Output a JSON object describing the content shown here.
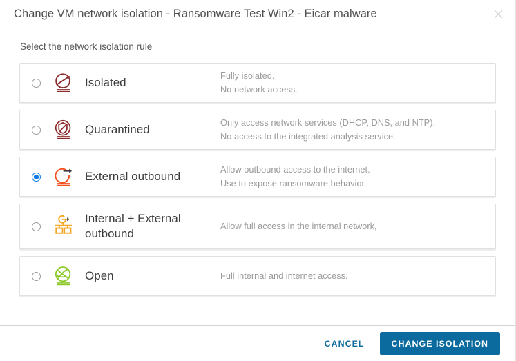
{
  "modal": {
    "title": "Change VM network isolation - Ransomware Test Win2 - Eicar malware",
    "close_icon": "close-icon",
    "instruction": "Select the network isolation rule"
  },
  "options": [
    {
      "id": "isolated",
      "label": "Isolated",
      "icon": "isolated-icon",
      "icon_color": "#8c2b2b",
      "selected": false,
      "description_lines": [
        "Fully isolated.",
        "No network access."
      ]
    },
    {
      "id": "quarantined",
      "label": "Quarantined",
      "icon": "quarantined-icon",
      "icon_color": "#8c2b2b",
      "selected": false,
      "description_lines": [
        "Only access network services (DHCP, DNS, and NTP).",
        "No access to the integrated analysis service."
      ]
    },
    {
      "id": "external-outbound",
      "label": "External outbound",
      "icon": "external-outbound-icon",
      "icon_color": "#f4511e",
      "selected": true,
      "description_lines": [
        "Allow outbound access to the internet.",
        "Use to expose ransomware behavior."
      ]
    },
    {
      "id": "internal-external-outbound",
      "label": "Internal + External outbound",
      "icon": "internal-external-outbound-icon",
      "icon_color": "#f5a623",
      "selected": false,
      "description_lines": [
        "Allow full access in the internal network,"
      ]
    },
    {
      "id": "open",
      "label": "Open",
      "icon": "open-icon",
      "icon_color": "#8bc926",
      "selected": false,
      "description_lines": [
        "Full internal and internet access."
      ]
    }
  ],
  "footer": {
    "cancel_label": "CANCEL",
    "confirm_label": "CHANGE ISOLATION",
    "accent_color": "#0c6b9e",
    "link_color": "#0f6a9e"
  },
  "colors": {
    "radio_selected": "#0d7ce8",
    "card_border": "#e0e0e0",
    "title_text": "#4f4f4f",
    "description_text": "#9b9b9b"
  }
}
